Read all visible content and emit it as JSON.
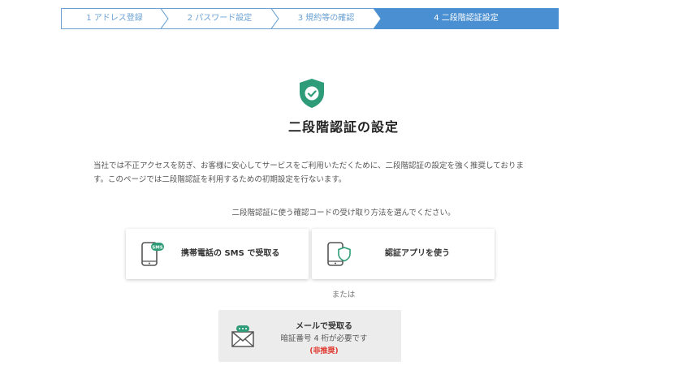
{
  "stepper": {
    "steps": [
      {
        "label": "1 アドレス登録"
      },
      {
        "label": "2 パスワード設定"
      },
      {
        "label": "3 規約等の確認"
      },
      {
        "label": "4 二段階認証設定"
      }
    ],
    "active_index": 3
  },
  "page": {
    "title": "二段階認証の設定",
    "description_line1": "当社では不正アクセスを防ぎ、お客様に安心してサービスをご利用いただくために、二段階認証の設定を強く推奨しておりま",
    "description_line2": "す。このページでは二段階認証を利用するための初期設定を行ないます。",
    "instruction": "二段階認証に使う確認コードの受け取り方法を選んでください。"
  },
  "options": {
    "sms_label": "携帯電話の SMS で受取る",
    "app_label": "認証アプリを使う",
    "or_text": "または",
    "mail_title": "メールで受取る",
    "mail_note": "暗証番号 4 桁が必要です",
    "mail_warning": "(非推奨)"
  },
  "colors": {
    "accent": "#4a8fd1",
    "shield": "#2e9c78",
    "warning": "#e0362c"
  },
  "icons": {
    "title_icon": "shield-check-icon",
    "sms_icon": "phone-sms-icon",
    "app_icon": "phone-shield-icon",
    "mail_icon": "envelope-icon"
  }
}
